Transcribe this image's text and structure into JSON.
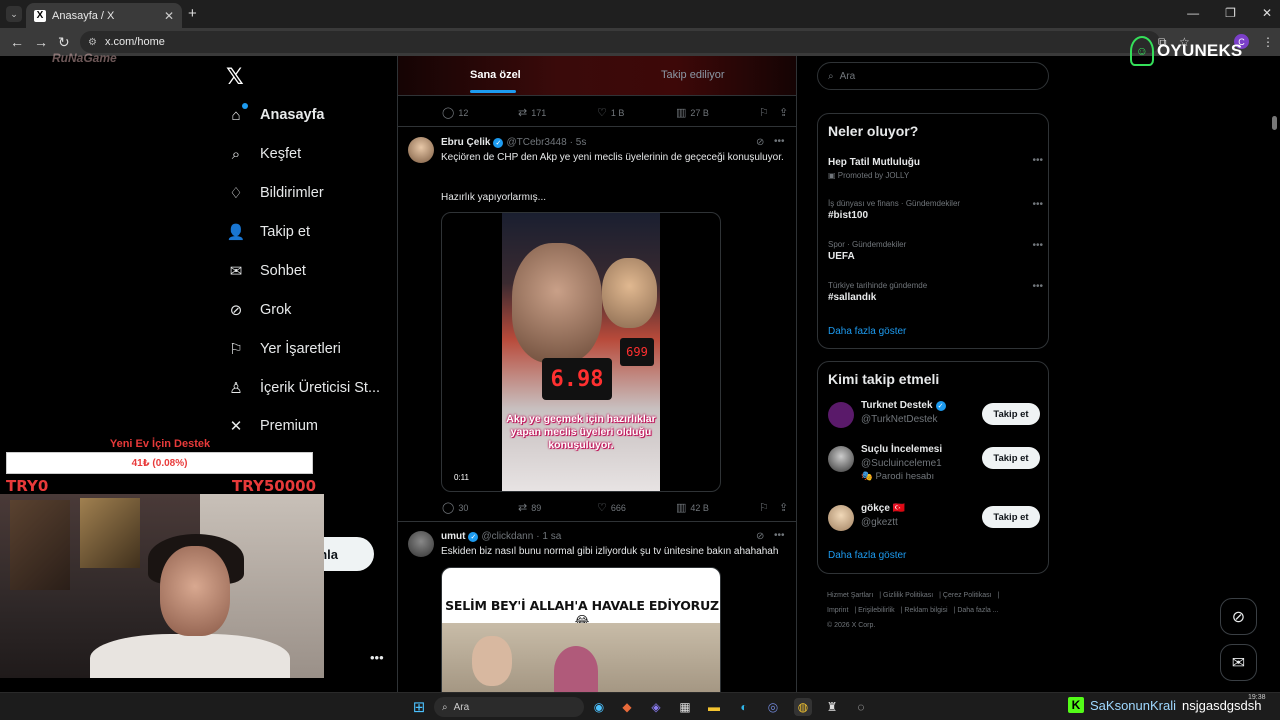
{
  "browser": {
    "tab_title": "Anasayfa / X",
    "url": "x.com/home",
    "profile_initial": "C"
  },
  "overlay": {
    "brand": "OYUNEKS",
    "watermark": "RuNaGame",
    "donation_title": "Yeni Ev İçin Destek",
    "donation_value": "41₺ (0.08%)",
    "donation_progress_percent": 0.08,
    "donation_min": "TRY0",
    "donation_max": "TRY50000",
    "stream_user": "SaKsonunKrali",
    "stream_message": "nsjgasdgsdsh"
  },
  "sidebar": {
    "items": [
      {
        "label": "Anasayfa"
      },
      {
        "label": "Keşfet"
      },
      {
        "label": "Bildirimler"
      },
      {
        "label": "Takip et"
      },
      {
        "label": "Sohbet"
      },
      {
        "label": "Grok"
      },
      {
        "label": "Yer İşaretleri"
      },
      {
        "label": "İçerik Üreticisi St..."
      },
      {
        "label": "Premium"
      }
    ],
    "post_button_partial": "nla"
  },
  "feed": {
    "tabs": [
      "Sana özel",
      "Takip ediliyor"
    ],
    "top_actions": {
      "replies": "12",
      "reposts": "171",
      "likes": "1 B",
      "views": "27 B"
    },
    "tweets": [
      {
        "name": "Ebru Çelik",
        "handle": "@TCebr3448",
        "time": "· 5s",
        "text1": "Keçiören de CHP den Akp ye yeni meclis üyelerinin de geçeceği konuşuluyor.",
        "text2": "Hazırlık yapıyorlarmış...",
        "video_caption": "Akp ye geçmek için hazırlıklar yapan meclis üyeleri olduğu konuşuluyor.",
        "video_counter": "6.98",
        "video_duration": "0:11",
        "replies": "30",
        "reposts": "89",
        "likes": "666",
        "views": "42 B"
      },
      {
        "name": "umut",
        "handle": "@clickdann",
        "time": "· 1 sa",
        "text1": "Eskiden biz nasıl bunu normal gibi izliyorduk şu tv ünitesine bakın ahahahah",
        "media_headline": "SELİM BEY'İ ALLAH'A HAVALE EDİYORUZ 😂"
      }
    ]
  },
  "right": {
    "search_placeholder": "Ara",
    "trends_title": "Neler oluyor?",
    "trends": [
      {
        "context": "",
        "name": "Hep Tatil Mutluluğu",
        "promo": "Promoted by JOLLY"
      },
      {
        "context": "İş dünyası ve finans · Gündemdekiler",
        "name": "#bist100",
        "promo": ""
      },
      {
        "context": "Spor · Gündemdekiler",
        "name": "UEFA",
        "promo": ""
      },
      {
        "context": "Türkiye tarihinde gündemde",
        "name": "#sallandık",
        "promo": ""
      }
    ],
    "show_more": "Daha fazla göster",
    "who_title": "Kimi takip etmeli",
    "who": [
      {
        "name": "Turknet Destek",
        "handle": "@TurkNetDestek",
        "parody": "",
        "button": "Takip et"
      },
      {
        "name": "Suçlu İncelemesi",
        "handle": "@Sucluinceleme1",
        "parody": "Parodi hesabı",
        "button": "Takip et"
      },
      {
        "name": "gökçe 🇹🇷",
        "handle": "@gkeztt",
        "parody": "",
        "button": "Takip et"
      }
    ],
    "footer": [
      "Hizmet Şartları",
      "Gizlilik Politikası",
      "Çerez Politikası",
      "Imprint",
      "Erişilebilirlik",
      "Reklam bilgisi",
      "Daha fazla ...",
      "© 2026 X Corp."
    ]
  },
  "taskbar": {
    "search_placeholder": "Ara",
    "time": "19:38"
  }
}
